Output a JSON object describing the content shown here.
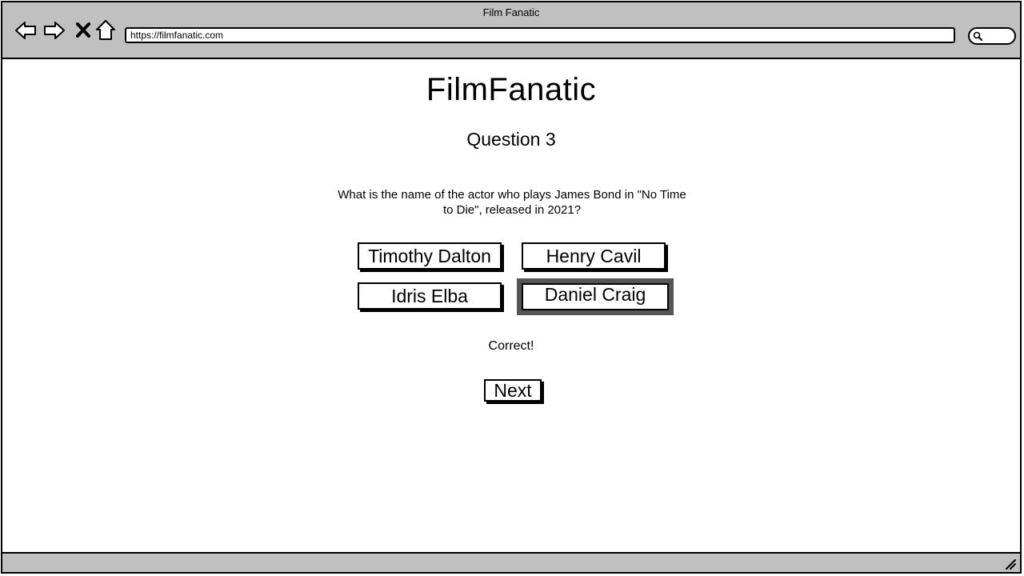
{
  "window": {
    "title": "Film Fanatic"
  },
  "toolbar": {
    "icons": [
      "back-arrow-icon",
      "forward-arrow-icon",
      "close-x-icon",
      "home-icon"
    ],
    "url": "https://filmfanatic.com",
    "search_icon": "search-icon"
  },
  "page": {
    "brand": "FilmFanatic",
    "question_title": "Question 3",
    "question_text": "What is the name of the actor who plays James Bond in \"No Time to Die\", released in 2021?",
    "answers": [
      {
        "label": "Timothy Dalton",
        "selected": false
      },
      {
        "label": "Henry Cavil",
        "selected": false
      },
      {
        "label": "Idris Elba",
        "selected": false
      },
      {
        "label": "Daniel Craig",
        "selected": true
      }
    ],
    "feedback": "Correct!",
    "next_label": "Next"
  },
  "colors": {
    "chrome": "#c0c0c0",
    "selected_border": "#555555"
  }
}
